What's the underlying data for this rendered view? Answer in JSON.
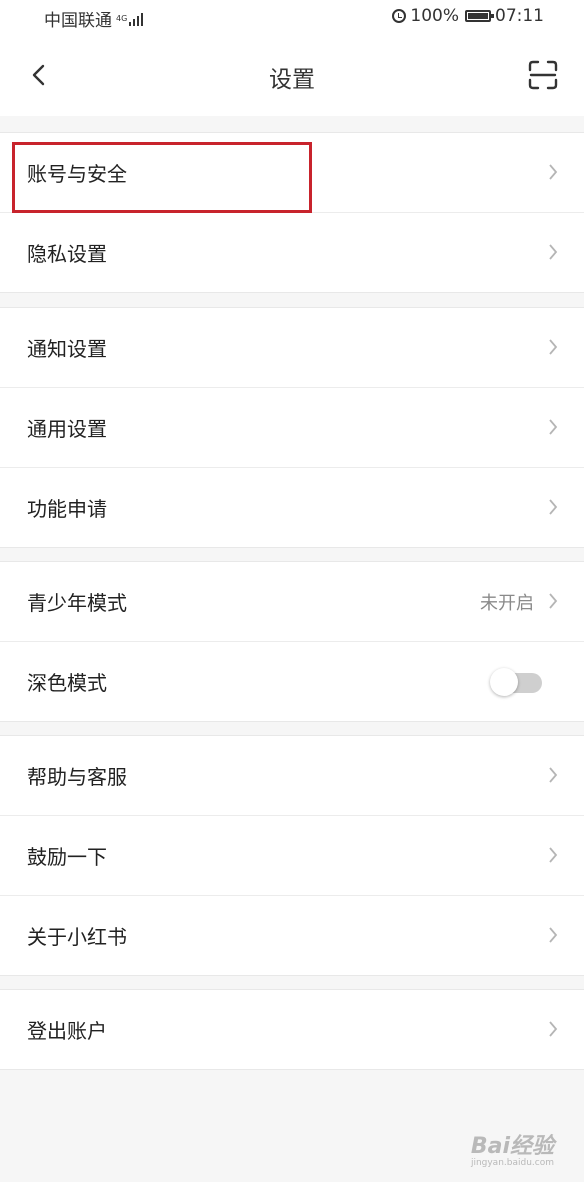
{
  "status_bar": {
    "carrier": "中国联通",
    "network": "4G",
    "battery": "100%",
    "time": "07:11"
  },
  "nav": {
    "title": "设置"
  },
  "sections": [
    {
      "items": [
        {
          "label": "账号与安全"
        },
        {
          "label": "隐私设置"
        }
      ]
    },
    {
      "items": [
        {
          "label": "通知设置"
        },
        {
          "label": "通用设置"
        },
        {
          "label": "功能申请"
        }
      ]
    },
    {
      "items": [
        {
          "label": "青少年模式",
          "value": "未开启"
        },
        {
          "label": "深色模式",
          "toggle": false
        }
      ]
    },
    {
      "items": [
        {
          "label": "帮助与客服"
        },
        {
          "label": "鼓励一下"
        },
        {
          "label": "关于小红书"
        }
      ]
    },
    {
      "items": [
        {
          "label": "登出账户"
        }
      ]
    }
  ],
  "watermark": {
    "logo": "Bai经验",
    "url": "jingyan.baidu.com"
  },
  "colors": {
    "highlight": "#c8232c",
    "background": "#f6f6f6"
  }
}
